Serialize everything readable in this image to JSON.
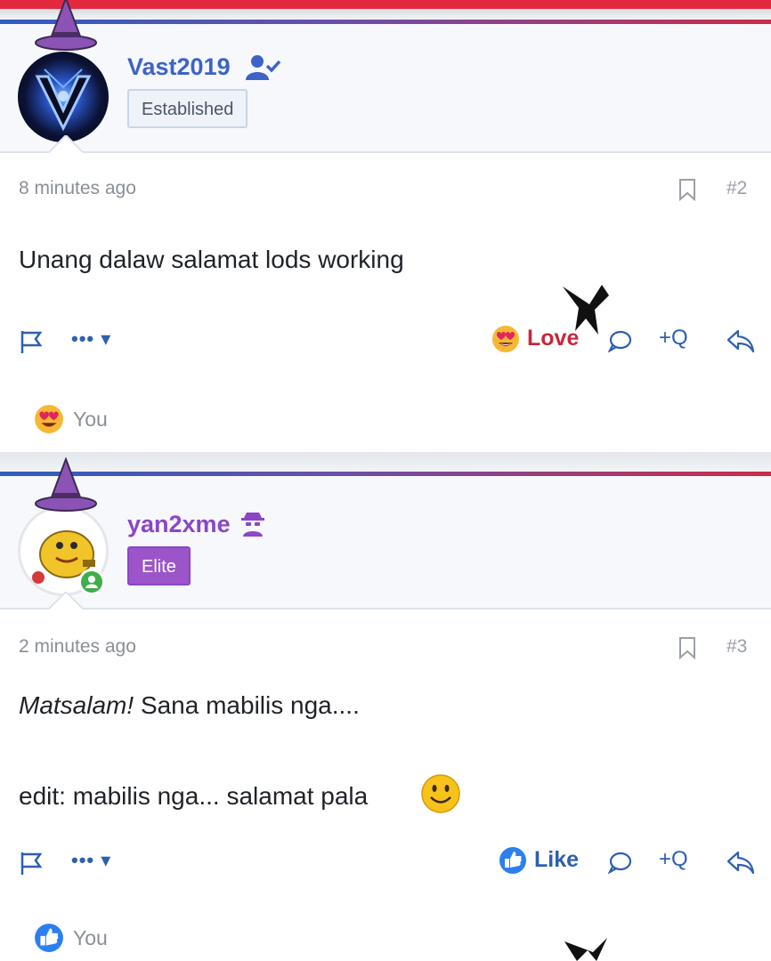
{
  "posts": [
    {
      "username": "Vast2019",
      "username_color": "#3d63c7",
      "role": "Established",
      "time": "8 minutes ago",
      "post_number": "#2",
      "message_italic": "",
      "message": "Unang dalaw salamat lods working",
      "reaction_label": "Love",
      "reaction_color": "#c6283c",
      "quote_label": "+Q",
      "reactor": "You"
    },
    {
      "username": "yan2xme",
      "username_color": "#8b46c7",
      "role": "Elite",
      "time": "2 minutes ago",
      "post_number": "#3",
      "message_italic": "Matsalam!",
      "message": "Sana mabilis nga....",
      "edit_text": "edit: mabilis nga... salamat pala",
      "reaction_label": "Like",
      "reaction_color": "#2d5fb2",
      "quote_label": "+Q",
      "reactor": "You"
    }
  ],
  "icons": [
    "wizard-hat-icon",
    "user-check-icon",
    "spy-icon",
    "online-icon",
    "bookmark-icon",
    "flag-icon",
    "more-icon",
    "heart-eyes-emoji",
    "comment-icon",
    "reply-icon",
    "thumbs-up-icon",
    "smile-emoji",
    "bat-sticker"
  ],
  "colors": {
    "accent": "#2d5fb2",
    "top_bar": "#e2283f",
    "elite_badge": "#9b55c9"
  }
}
